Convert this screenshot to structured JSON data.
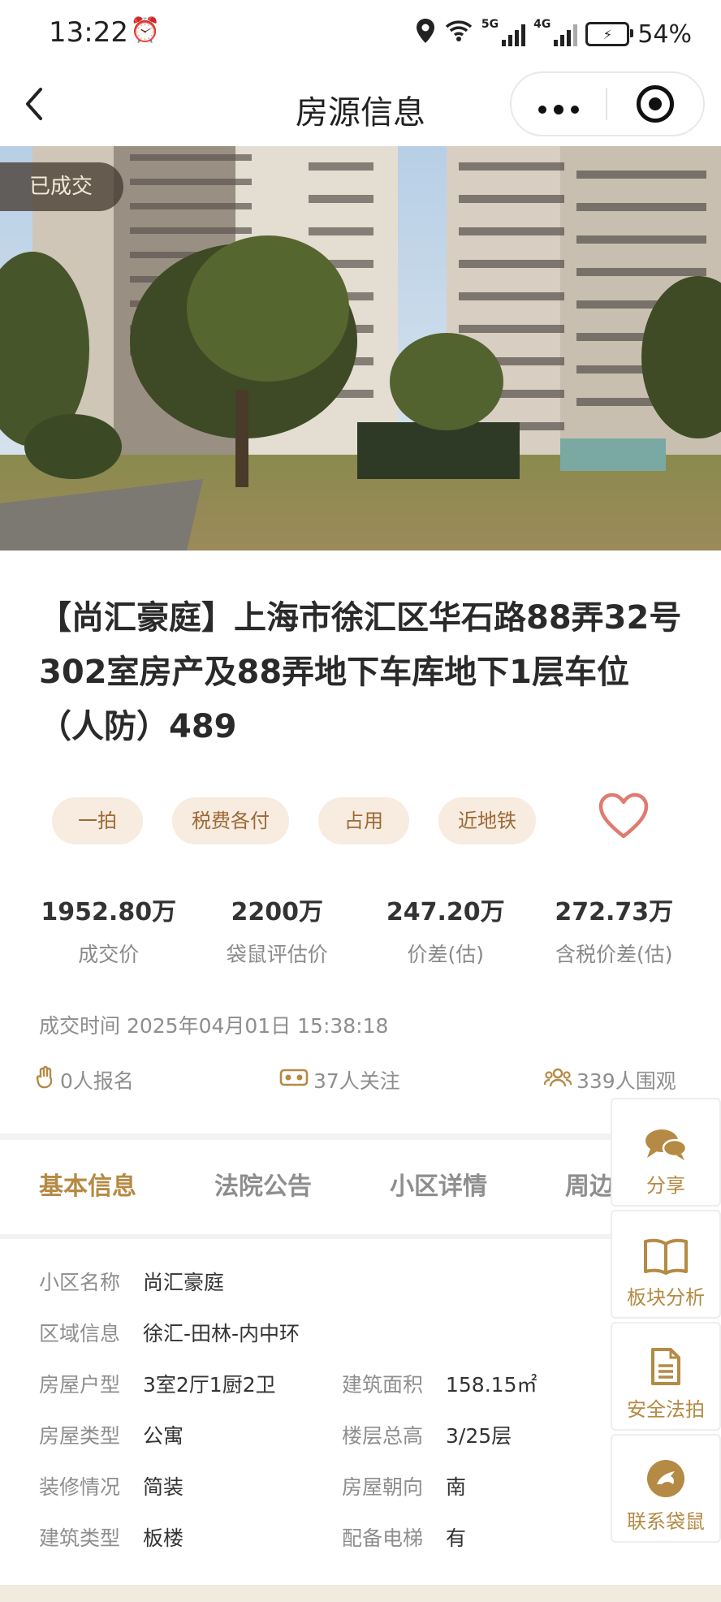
{
  "status_bar": {
    "time": "13:22",
    "battery": "54%",
    "net1": "5G",
    "net2": "4G"
  },
  "nav": {
    "title": "房源信息"
  },
  "hero": {
    "badge": "已成交"
  },
  "house": {
    "title": "【尚汇豪庭】上海市徐汇区华石路88弄32号302室房产及88弄地下车库地下1层车位（人防）489",
    "tags": [
      "一拍",
      "税费各付",
      "占用",
      "近地铁"
    ]
  },
  "stats": [
    {
      "value": "1952.80万",
      "label": "成交价"
    },
    {
      "value": "2200万",
      "label": "袋鼠评估价"
    },
    {
      "value": "247.20万",
      "label": "价差(估)"
    },
    {
      "value": "272.73万",
      "label": "含税价差(估)"
    }
  ],
  "deal_time": "成交时间 2025年04月01日 15:38:18",
  "metrics": {
    "signups": "0人报名",
    "follows": "37人关注",
    "views": "339人围观"
  },
  "tabs": [
    "基本信息",
    "法院公告",
    "小区详情",
    "周边"
  ],
  "info": {
    "community_label": "小区名称",
    "community": "尚汇豪庭",
    "region_label": "区域信息",
    "region": "徐汇-田林-内中环",
    "layout_label": "房屋户型",
    "layout": "3室2厅1厨2卫",
    "area_label": "建筑面积",
    "area": "158.15㎡",
    "type_label": "房屋类型",
    "type": "公寓",
    "floor_label": "楼层总高",
    "floor": "3/25层",
    "decor_label": "装修情况",
    "decor": "简装",
    "orient_label": "房屋朝向",
    "orient": "南",
    "build_label": "建筑类型",
    "build": "板楼",
    "elevator_label": "配备电梯",
    "elevator": "有"
  },
  "float_buttons": [
    "分享",
    "板块分析",
    "安全法拍",
    "联系袋鼠"
  ],
  "colors": {
    "accent": "#b58a44",
    "tag_bg": "#f8ebdf",
    "heart": "#e07b6f"
  }
}
